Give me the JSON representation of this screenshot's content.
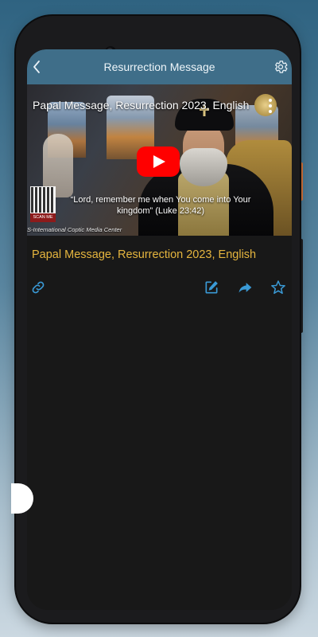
{
  "appbar": {
    "title": "Resurrection Message",
    "back_icon": "chevron-left-icon",
    "settings_icon": "gear-icon"
  },
  "video": {
    "title": "Papal Message, Resurrection 2023, English",
    "caption": "“Lord, remember me when You come into Your kingdom” (Luke 23:42)",
    "qr_label": "SCAN ME",
    "credit": "S-International Coptic Media Center",
    "play_icon": "youtube-play-icon",
    "more_icon": "more-vertical-icon"
  },
  "item": {
    "title": "Papal Message, Resurrection 2023, English"
  },
  "actions": {
    "link_icon": "link-icon",
    "edit_icon": "edit-icon",
    "share_icon": "share-icon",
    "favorite_icon": "star-icon"
  },
  "colors": {
    "appbar_bg": "#3f6e89",
    "accent_icon": "#3a9ad6",
    "title_gold": "#e5b53e",
    "screen_bg": "#181818",
    "youtube_red": "#ff0000"
  }
}
